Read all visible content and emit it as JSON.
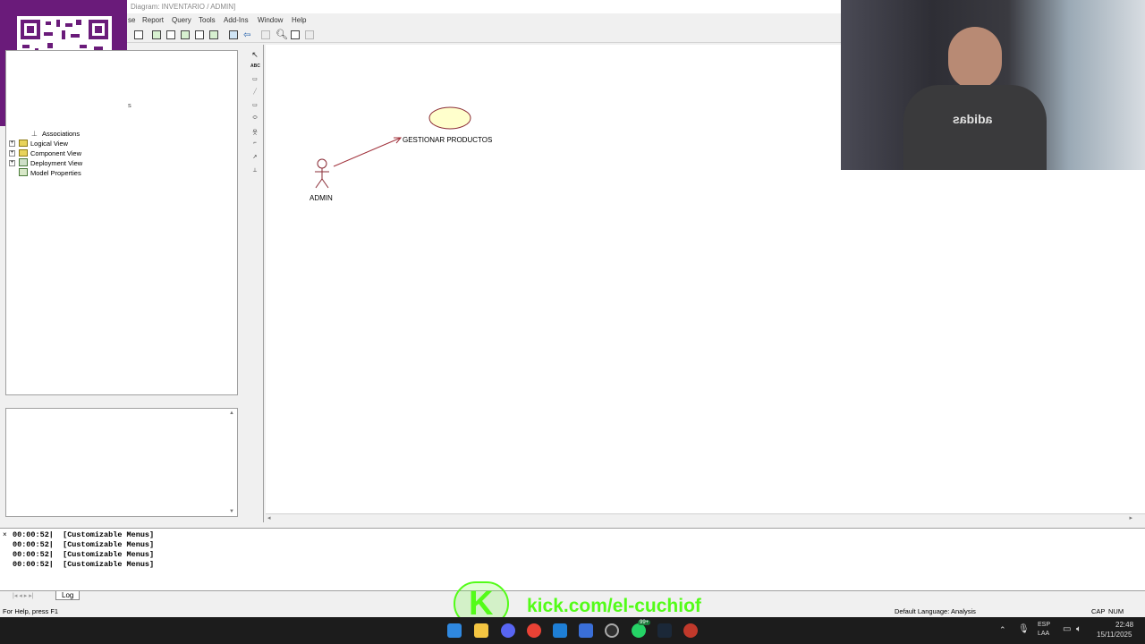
{
  "window": {
    "title": "Diagram: INVENTARIO / ADMIN]"
  },
  "menu": {
    "items": [
      "se",
      "Report",
      "Query",
      "Tools",
      "Add-Ins",
      "Window",
      "Help"
    ]
  },
  "tree": {
    "partial_label": "s",
    "items": [
      {
        "label": "Associations"
      },
      {
        "label": "Logical View"
      },
      {
        "label": "Component View"
      },
      {
        "label": "Deployment View"
      },
      {
        "label": "Model Properties"
      }
    ]
  },
  "diagram": {
    "actor": {
      "label": "ADMIN"
    },
    "use_case": {
      "label": "GESTIONAR PRODUCTOS"
    },
    "use_case_color": "#ffffcc",
    "association_color": "#a0303a"
  },
  "palette": {
    "tools": [
      "selection-arrow",
      "text-box",
      "note",
      "anchor",
      "package",
      "use-case",
      "actor",
      "unidirectional-association",
      "dependency",
      "generalization"
    ]
  },
  "log": {
    "lines": [
      "00:00:52|  [Customizable Menus]",
      "00:00:52|  [Customizable Menus]",
      "00:00:52|  [Customizable Menus]",
      "00:00:52|  [Customizable Menus]"
    ],
    "tab": "Log"
  },
  "status": {
    "help": "For Help, press F1",
    "language": "Default Language: Analysis",
    "caps": "CAP",
    "num": "NUM"
  },
  "overlay": {
    "qr_label": "yape",
    "stream_url": "kick.com/el-cuchiof",
    "stream_logo": "K",
    "shirt_text": "adidas",
    "brand_color": "#53fc18"
  },
  "taskbar": {
    "apps": [
      "windows-start",
      "file-explorer",
      "discord",
      "chrome",
      "vscode",
      "rational-rose",
      "obs",
      "whatsapp",
      "steam",
      "app"
    ],
    "whatsapp_badge": "99+",
    "lang": "ESP",
    "layout": "LAA",
    "time": "22:48",
    "date": "15/11/2025"
  }
}
